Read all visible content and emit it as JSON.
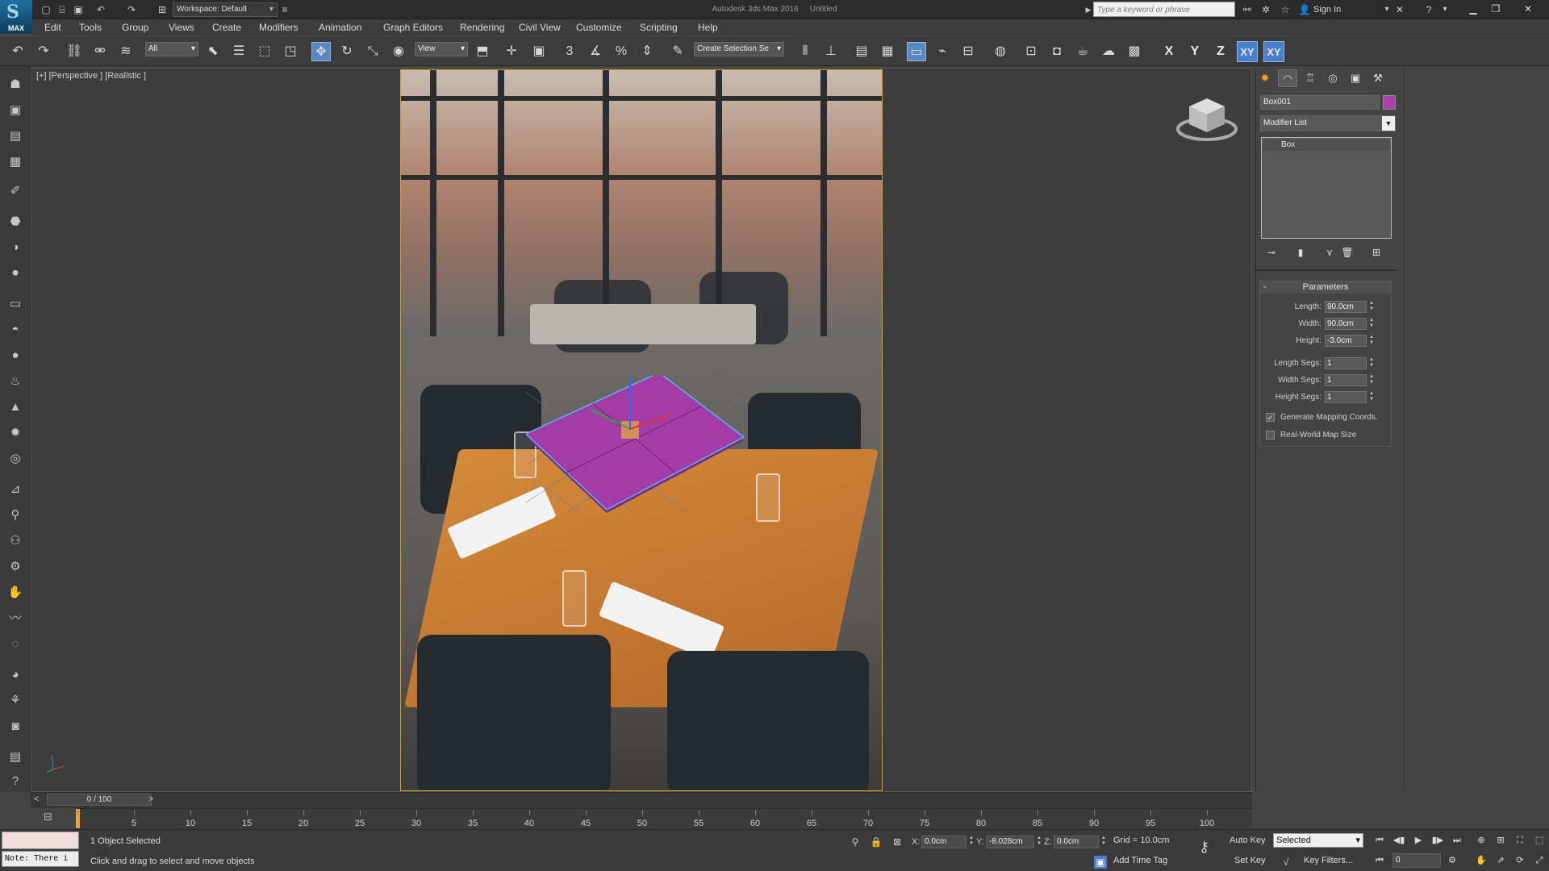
{
  "titlebar": {
    "app_title": "Autodesk 3ds Max 2016",
    "doc_title": "Untitled",
    "workspace": "Workspace: Default",
    "search_placeholder": "Type a keyword or phrase",
    "sign_in": "Sign In",
    "logo_text": "MAX"
  },
  "menu": [
    "Edit",
    "Tools",
    "Group",
    "Views",
    "Create",
    "Modifiers",
    "Animation",
    "Graph Editors",
    "Rendering",
    "Civil View",
    "Customize",
    "Scripting",
    "Help"
  ],
  "toolbar": {
    "selection_filter": "All",
    "ref_coord": "View",
    "named_selection": "Create Selection Se",
    "snap_3": "3",
    "axes": [
      "X",
      "Y",
      "Z",
      "XY",
      "XY"
    ]
  },
  "viewport": {
    "label": "[+] [Perspective ] [Realistic ]"
  },
  "command_panel": {
    "object_name": "Box001",
    "object_color": "#b03fb0",
    "modifier_list": "Modifier List",
    "stack": [
      "Box"
    ],
    "rollout_title": "Parameters",
    "rollout_collapse": "-",
    "params": [
      {
        "label": "Length:",
        "value": "90.0cm"
      },
      {
        "label": "Width:",
        "value": "90.0cm"
      },
      {
        "label": "Height:",
        "value": "-3.0cm"
      },
      {
        "label": "Length Segs:",
        "value": "1"
      },
      {
        "label": "Width Segs:",
        "value": "1"
      },
      {
        "label": "Height Segs:",
        "value": "1"
      }
    ],
    "checkboxes": [
      {
        "label": "Generate Mapping Coords.",
        "checked": true
      },
      {
        "label": "Real-World Map Size",
        "checked": false
      }
    ]
  },
  "timeline": {
    "slider": "0 / 100",
    "prev": "<",
    "next": ">",
    "ticks": [
      "5",
      "10",
      "15",
      "20",
      "25",
      "30",
      "35",
      "40",
      "45",
      "50",
      "55",
      "60",
      "65",
      "70",
      "75",
      "80",
      "85",
      "90",
      "95",
      "100"
    ]
  },
  "status": {
    "note": "Note: There i",
    "selection": "1 Object Selected",
    "hint": "Click and drag to select and move objects",
    "x_label": "X:",
    "x_value": "0.0cm",
    "y_label": "Y:",
    "y_value": "-8.028cm",
    "z_label": "Z:",
    "z_value": "0.0cm",
    "grid": "Grid = 10.0cm",
    "add_time_tag": "Add Time Tag",
    "auto_key": "Auto Key",
    "set_key": "Set Key",
    "key_mode": "Selected",
    "key_filters": "Key Filters...",
    "frame": "0"
  }
}
